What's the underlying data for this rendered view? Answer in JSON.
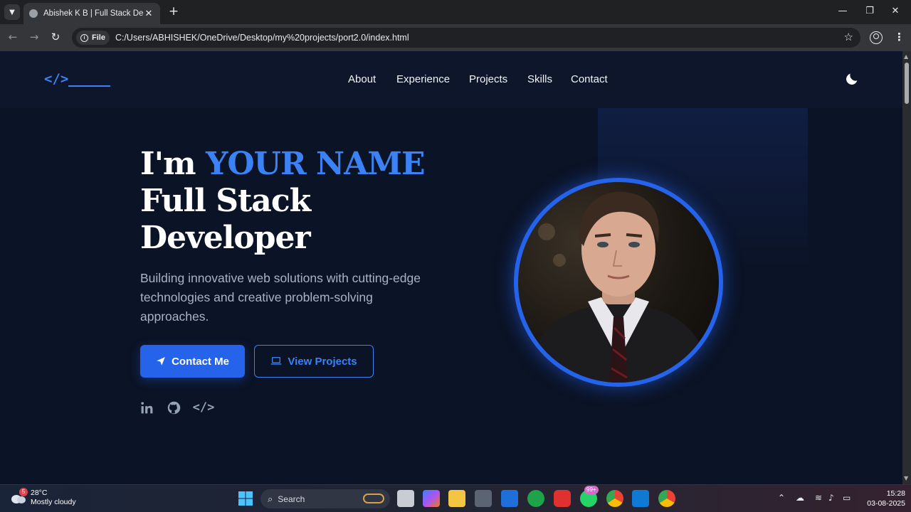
{
  "browser": {
    "tab_title": "Abishek K B | Full Stack Developer",
    "new_tab_symbol": "+",
    "close_symbol": "✕",
    "file_chip": "File",
    "url": "C:/Users/ABHISHEK/OneDrive/Desktop/my%20projects/port2.0/index.html"
  },
  "site": {
    "logo": "</>",
    "nav": [
      "About",
      "Experience",
      "Projects",
      "Skills",
      "Contact"
    ],
    "hero": {
      "greeting": "I'm ",
      "name": "YOUR NAME",
      "role_line1": "Full Stack",
      "role_line2": "Developer",
      "subtitle": "Building innovative web solutions with cutting-edge technologies and creative problem-solving approaches.",
      "primary_button": "Contact Me",
      "secondary_button": "View Projects"
    },
    "social_icons": [
      "linkedin-icon",
      "github-icon",
      "code-icon"
    ],
    "colors": {
      "accent": "#3b82f6",
      "background": "#0b1326",
      "button": "#2563eb"
    }
  },
  "taskbar": {
    "weather_temp": "28°C",
    "weather_desc": "Mostly cloudy",
    "weather_badge": "5",
    "search_label": "Search",
    "whatsapp_badge": "99+",
    "time": "15:28",
    "date": "03-08-2025"
  }
}
